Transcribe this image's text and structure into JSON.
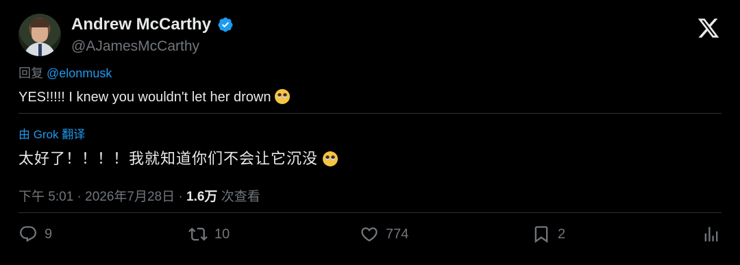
{
  "author": {
    "name": "Andrew McCarthy",
    "handle": "@AJamesMcCarthy",
    "verified_color": "#1d9bf0"
  },
  "reply": {
    "prefix": "回复",
    "mention": "@elonmusk"
  },
  "tweet": {
    "text": "YES!!!!! I knew you wouldn't let her drown",
    "emoji": "pleading-face-icon"
  },
  "translation": {
    "label": "由 Grok 翻译",
    "text": "太好了！！！！我就知道你们不会让它沉没"
  },
  "meta": {
    "time": "下午 5:01",
    "sep1": "·",
    "date": "2026年7月28日",
    "sep2": "·",
    "views": "1.6万",
    "views_label": "次查看"
  },
  "actions": {
    "replies": "9",
    "reposts": "10",
    "likes": "774",
    "bookmarks": "2"
  },
  "colors": {
    "background": "#000000",
    "text": "#e7e9ea",
    "muted": "#71767b",
    "accent": "#1d9bf0",
    "divider": "#2f3336"
  }
}
